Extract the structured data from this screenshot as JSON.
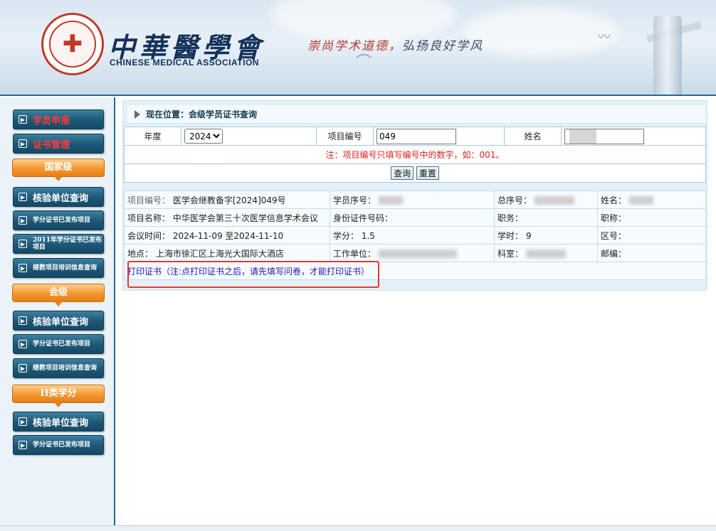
{
  "header": {
    "logo_cn": "中華醫學會",
    "logo_en": "CHINESE MEDICAL ASSOCIATION",
    "slogan_a": "崇尚学术道德，",
    "slogan_b": "弘扬良好学风"
  },
  "sidebar": {
    "items": [
      {
        "label": "学员申报",
        "style": "red"
      },
      {
        "label": "证书管理",
        "style": "red"
      }
    ],
    "sections": [
      {
        "title": "国家级",
        "items": [
          "核验单位查询",
          "学分证书已发布项目",
          "2011年学分证书已发布项目",
          "继教项目培训信息查询"
        ]
      },
      {
        "title": "会级",
        "items": [
          "核验单位查询",
          "学分证书已发布项目",
          "继教项目培训信息查询"
        ]
      },
      {
        "title": "II类学分",
        "items": [
          "核验单位查询",
          "学分证书已发布项目"
        ]
      }
    ]
  },
  "breadcrumb": "现在位置：会级学员证书查询",
  "query": {
    "year_label": "年度",
    "year_value": "2024",
    "project_no_label": "项目编号",
    "project_no_value": "049",
    "name_label": "姓名",
    "note": "注：项目编号只填写编号中的数字，如：001。",
    "search_btn": "查询",
    "reset_btn": "重置"
  },
  "result": {
    "row1": {
      "k1": "项目编号：",
      "v1": "医学会继教备字[2024]049号",
      "k2": "学员序号：",
      "k3": "总序号：",
      "k4": "姓名："
    },
    "row2": {
      "k1": "项目名称：",
      "v1": "中华医学会第三十次医学信息学术会议",
      "k2": "身份证件号码：",
      "k3": "职务：",
      "k4": "职称："
    },
    "row3": {
      "k1": "会议时间：",
      "v1": "2024-11-09 至2024-11-10",
      "k2": "学分：",
      "v2": "1.5",
      "k3": "学时：",
      "v3": "9",
      "k4": "区号："
    },
    "row4": {
      "k1": "地点：",
      "v1": "上海市徐汇区上海光大国际大酒店",
      "k2": "工作单位：",
      "k3": "科室：",
      "k4": "邮编："
    },
    "print_link": "打印证书（注:点打印证书之后，请先填写问卷，才能打印证书）"
  },
  "colors": {
    "accent": "#1d6e8c",
    "note_red": "#e02020",
    "link_blue": "#1a1aa8",
    "highlight": "#e53935"
  }
}
